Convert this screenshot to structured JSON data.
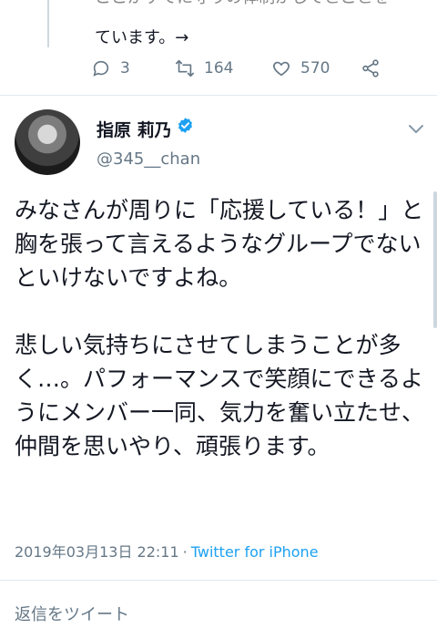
{
  "previous_tweet": {
    "text_cut_line": "ここがすでに守りの体制がしてとことを",
    "text_line2": "ています。→",
    "actions": {
      "reply_count": "3",
      "retweet_count": "164",
      "like_count": "570"
    }
  },
  "tweet": {
    "display_name": "指原 莉乃",
    "handle": "@345__chan",
    "text": "みなさんが周りに「応援している！」と胸を張って言えるようなグループでないといけないですよね。\n\n悲しい気持ちにさせてしまうことが多く…。パフォーマンスで笑顔にできるようにメンバー一同、気力を奮い立たせ、仲間を思いやり、頑張ります。",
    "timestamp": "2019年03月13日 22:11",
    "separator": "·",
    "source": "Twitter for iPhone"
  },
  "reply_bar": {
    "placeholder": "返信をツイート"
  },
  "colors": {
    "accent": "#1da1f2",
    "muted": "#657786",
    "text": "#141823"
  }
}
